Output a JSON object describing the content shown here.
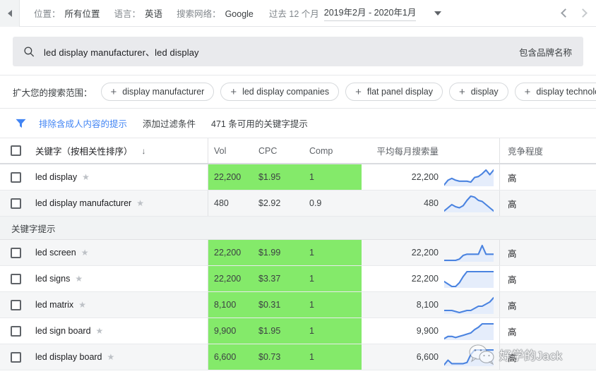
{
  "topbar": {
    "collapse_icon": "triangle-left-icon",
    "filters": [
      {
        "label": "位置：",
        "value": "所有位置"
      },
      {
        "label": "语言：",
        "value": "英语"
      },
      {
        "label": "搜索网络：",
        "value": "Google"
      }
    ],
    "date_prefix": "过去 12 个月",
    "date_value": "2019年2月 - 2020年1月",
    "caret_icon": "chevron-down-icon",
    "prev_icon": "chevron-left-icon",
    "next_icon": "chevron-right-icon"
  },
  "search": {
    "icon": "search-icon",
    "query": "led display manufacturer、led display",
    "brand_note": "包含品牌名称"
  },
  "expand": {
    "label": "扩大您的搜索范围：",
    "chips": [
      "display manufacturer",
      "led display companies",
      "flat panel display",
      "display",
      "display technology",
      ""
    ]
  },
  "hints": {
    "filter_icon": "funnel-icon",
    "exclude_adult": "排除含成人内容的提示",
    "add_filter": "添加过滤条件",
    "count_text": "471 条可用的关键字提示"
  },
  "table": {
    "headers": {
      "keyword": "关键字（按相关性排序）",
      "sort_icon": "arrow-down-icon",
      "vol": "Vol",
      "cpc": "CPC",
      "comp": "Comp",
      "avg_monthly": "平均每月搜索量",
      "competition": "竞争程度"
    },
    "group_label": "关键字提示",
    "highlight_color": "#84ea6a",
    "rows_top": [
      {
        "keyword": "led display",
        "vol": "22,200",
        "cpc": "$1.95",
        "comp": "1",
        "avg": "22,200",
        "level": "高",
        "highlight": true,
        "spark": "2,7,9,7,6,6,6,5,10,11,14,18,13,18"
      },
      {
        "keyword": "led display manufacturer",
        "vol": "480",
        "cpc": "$2.92",
        "comp": "0.9",
        "avg": "480",
        "level": "高",
        "highlight": false,
        "spark": "3,6,9,7,6,8,13,17,16,13,12,9,6,3"
      }
    ],
    "rows_suggested": [
      {
        "keyword": "led screen",
        "vol": "22,200",
        "cpc": "$1.99",
        "comp": "1",
        "avg": "22,200",
        "level": "高",
        "highlight": true,
        "spark": "5,5,5,5,6,9,10,10,10,10,17,10,10,10"
      },
      {
        "keyword": "led signs",
        "vol": "22,200",
        "cpc": "$3.37",
        "comp": "1",
        "avg": "22,200",
        "level": "高",
        "highlight": true,
        "spark": "8,6,4,4,7,12,16,16,16,16,16,16,16,16"
      },
      {
        "keyword": "led matrix",
        "vol": "8,100",
        "cpc": "$0.31",
        "comp": "1",
        "avg": "8,100",
        "level": "高",
        "highlight": true,
        "spark": "6,6,6,5,4,5,6,6,8,10,10,12,14,18"
      },
      {
        "keyword": "led sign board",
        "vol": "9,900",
        "cpc": "$1.95",
        "comp": "1",
        "avg": "9,900",
        "level": "高",
        "highlight": true,
        "spark": "4,6,6,5,6,7,8,9,12,14,17,17,17,17"
      },
      {
        "keyword": "led display board",
        "vol": "6,600",
        "cpc": "$0.73",
        "comp": "1",
        "avg": "6,600",
        "level": "高",
        "highlight": true,
        "spark": "3,7,4,4,4,4,5,12,16,16,16,16,16,16"
      }
    ]
  },
  "watermark": {
    "icon": "wechat-icon",
    "text": "好学的Jack"
  }
}
